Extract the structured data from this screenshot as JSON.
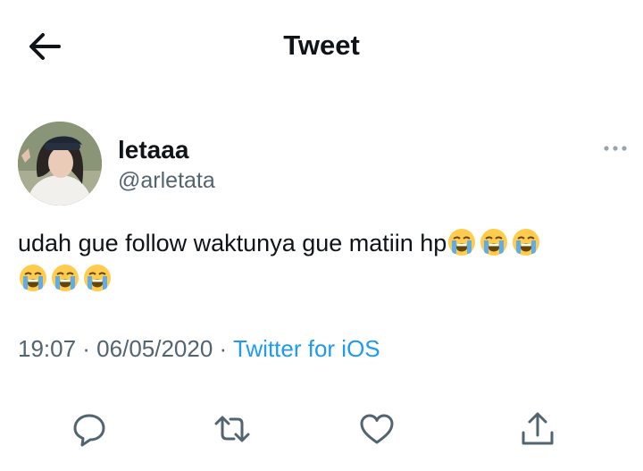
{
  "header": {
    "title": "Tweet",
    "back_icon": "arrow-left-icon"
  },
  "author": {
    "display_name": "letaaa",
    "handle": "@arletata",
    "avatar": "profile-photo"
  },
  "tweet": {
    "text": "udah gue follow waktunya gue matiin hp",
    "emoji": "loudly-crying-face",
    "emoji_count": 6,
    "timestamp": "19:07 · 06/05/2020 · ",
    "source": "Twitter for iOS"
  },
  "actions": [
    {
      "name": "reply",
      "icon": "speech-bubble-icon"
    },
    {
      "name": "retweet",
      "icon": "retweet-arrows-icon"
    },
    {
      "name": "like",
      "icon": "heart-icon"
    },
    {
      "name": "share",
      "icon": "share-upload-icon"
    }
  ],
  "colors": {
    "text": "#0f1419",
    "secondary": "#536471",
    "accent": "#1d9bf0",
    "background": "#ffffff"
  }
}
